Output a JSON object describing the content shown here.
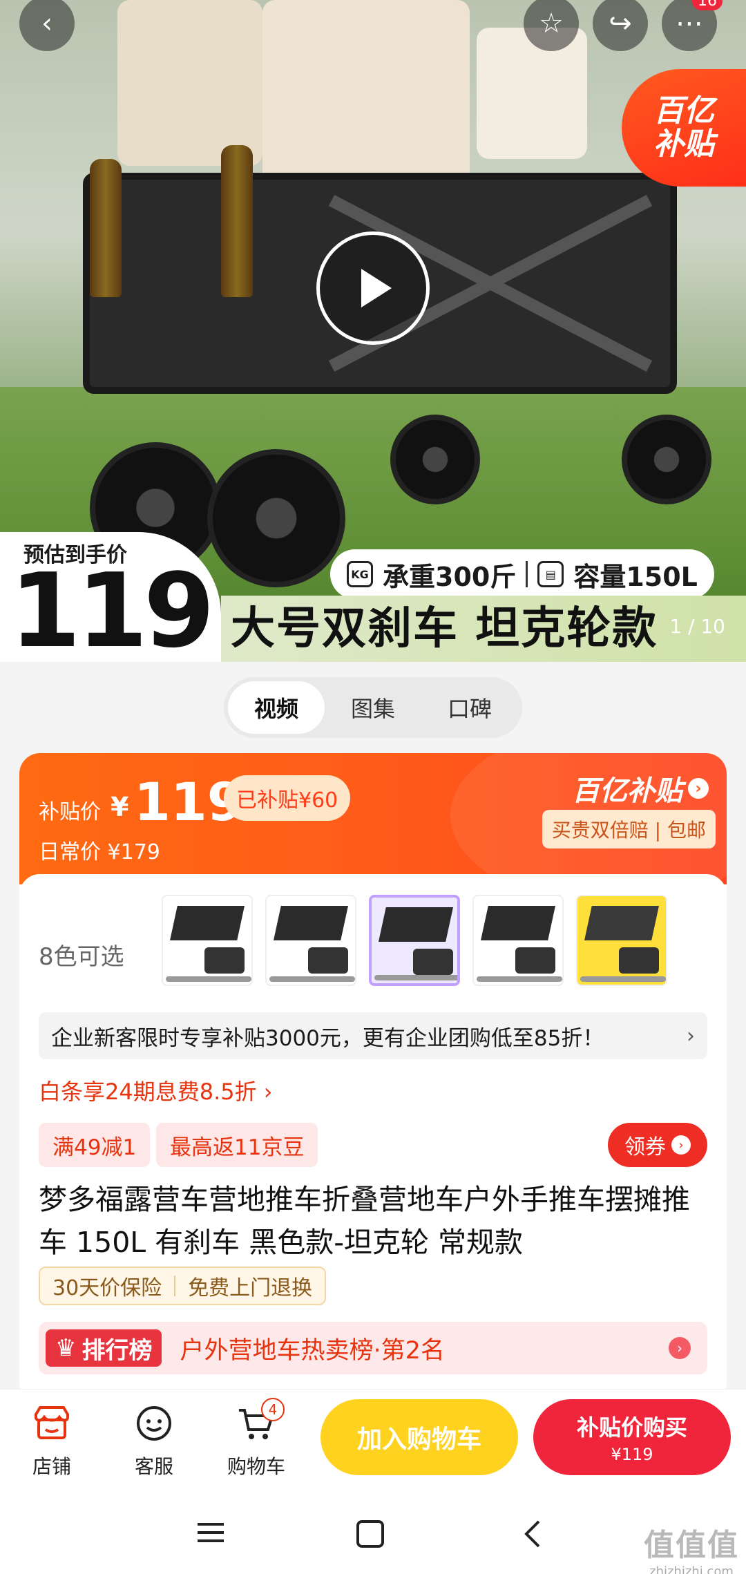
{
  "hero": {
    "yi_badge_line1": "百亿",
    "yi_badge_line2": "补贴",
    "price_label": "预估到手价",
    "price_value": "119",
    "load_text": "承重300斤",
    "capacity_text": "容量150L",
    "slogan": "大号双刹车 坦克轮款",
    "page_indicator": "1 / 10",
    "more_badge_count": "16",
    "icons": [
      "back-icon",
      "favorite-star-icon",
      "share-icon",
      "more-icon",
      "play-icon"
    ]
  },
  "media_tabs": [
    {
      "label": "视频",
      "active": true
    },
    {
      "label": "图集",
      "active": false
    },
    {
      "label": "口碑",
      "active": false
    }
  ],
  "price_card": {
    "subsidy_label": "补贴价",
    "currency": "¥",
    "subsidy_price": "119",
    "saved_text": "已补贴¥60",
    "daily_price_text": "日常价 ¥179",
    "yi_brand": "百亿补贴",
    "yi_tag": "买贵双倍赔 | 包邮"
  },
  "colors": {
    "label": "8色可选"
  },
  "enterprise_bar": {
    "text": "企业新客限时专享补贴3000元，更有企业团购低至85折！",
    "chevron": "›"
  },
  "baitiao": {
    "text": "白条享24期息费8.5折 ›"
  },
  "coupons": [
    {
      "label": "满49减1"
    },
    {
      "label": "最高返11京豆"
    }
  ],
  "get_coupon_label": "领券",
  "title": "梦多福露营车营地推车折叠营地车户外手推车摆摊推车 150L 有刹车 黑色款-坦克轮 常规款",
  "guarantees": [
    "30天价保险",
    "免费上门退换"
  ],
  "rank": {
    "badge": "排行榜",
    "text": "户外营地车热卖榜·第2名"
  },
  "bottom_bar": {
    "store_label": "店铺",
    "service_label": "客服",
    "cart_label": "购物车",
    "cart_count": "4",
    "add_to_cart_label": "加入购物车",
    "buy_label": "补贴价购买",
    "buy_price": "¥119"
  },
  "watermark": {
    "line1": "值值值",
    "line2": "zhizhizhi.com"
  },
  "colors_theme": {
    "accent_orange": "#ff5a1a",
    "accent_red": "#f0243a",
    "accent_yellow": "#ffd21f"
  }
}
